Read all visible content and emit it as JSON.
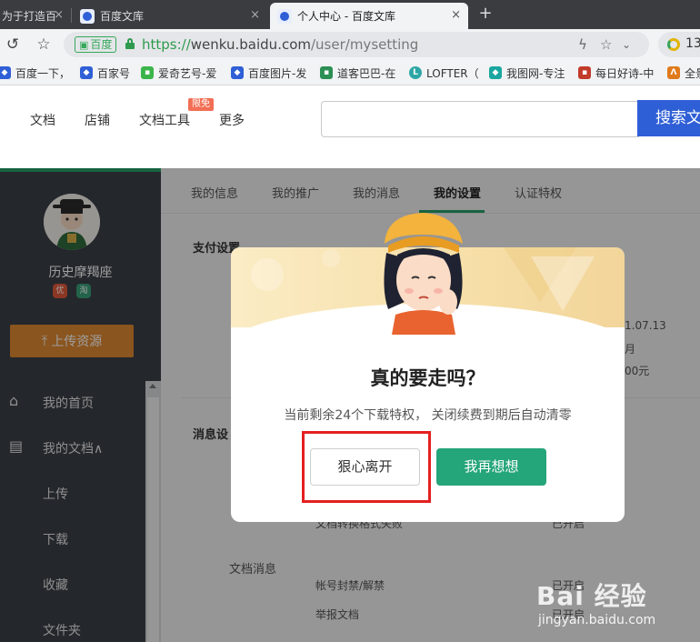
{
  "browser": {
    "tabs": [
      {
        "title": "为于打造百",
        "active": false
      },
      {
        "title": "百度文库",
        "active": false
      },
      {
        "title": "个人中心 - 百度文库",
        "active": true
      }
    ],
    "close_glyph": "×",
    "newtab_glyph": "+",
    "url_scheme": "https://",
    "url_host": "wenku.baidu.com",
    "url_path": "/user/mysetting",
    "cert_label": "百度",
    "ext_count": "13",
    "bookmarks": [
      {
        "label": "百度一下，",
        "color": "#2f5fd6"
      },
      {
        "label": "百家号",
        "color": "#2f5fd6"
      },
      {
        "label": "爱奇艺号-爱",
        "color": "#3bb54a"
      },
      {
        "label": "百度图片-发",
        "color": "#2f5fd6"
      },
      {
        "label": "道客巴巴-在",
        "color": "#2c8f54"
      },
      {
        "label": "LOFTER（",
        "color": "#2fa6a6"
      },
      {
        "label": "我图网-专注",
        "color": "#1aa6a0"
      },
      {
        "label": "每日好诗-中",
        "color": "#c23a2a"
      },
      {
        "label": "全景",
        "color": "#e07a1a"
      }
    ]
  },
  "site": {
    "nav": [
      "文档",
      "店铺",
      "文档工具",
      "更多"
    ],
    "limited_badge": "限免",
    "search_button": "搜索文"
  },
  "sidebar": {
    "username": "历史摩羯座",
    "badges": [
      "优",
      "淘"
    ],
    "upload_button": "上传资源",
    "menu": [
      {
        "label": "我的首页",
        "icon": "home-icon"
      },
      {
        "label": "我的文档∧",
        "icon": "document-icon"
      },
      {
        "label": "上传",
        "icon": ""
      },
      {
        "label": "下载",
        "icon": ""
      },
      {
        "label": "收藏",
        "icon": ""
      },
      {
        "label": "文件夹",
        "icon": ""
      }
    ]
  },
  "main": {
    "tabs": [
      "我的信息",
      "我的推广",
      "我的消息",
      "我的设置",
      "认证特权"
    ],
    "active_tab": "我的设置",
    "payment_title": "支付设置",
    "message_title": "消息设",
    "doc_message_label": "文档消息",
    "bg_items": [
      "1.07.13",
      "月",
      "00元",
      "文档转换格式失败",
      "已开启",
      "帐号封禁/解禁",
      "已开启",
      "举报文档",
      "已开启"
    ]
  },
  "modal": {
    "title": "真的要走吗？",
    "description": "当前剩余24个下载特权， 关闭续费到期后自动清零",
    "leave_button": "狠心离开",
    "stay_button": "我再想想"
  },
  "watermark": {
    "brand": "Bai 经验",
    "url": "jingyan.baidu.com"
  },
  "colors": {
    "accent_green": "#25a57a",
    "sidebar_bg": "#3b3f47",
    "upload_orange": "#df8a33",
    "search_blue": "#2f5fd6",
    "highlight_red": "#e32020"
  }
}
